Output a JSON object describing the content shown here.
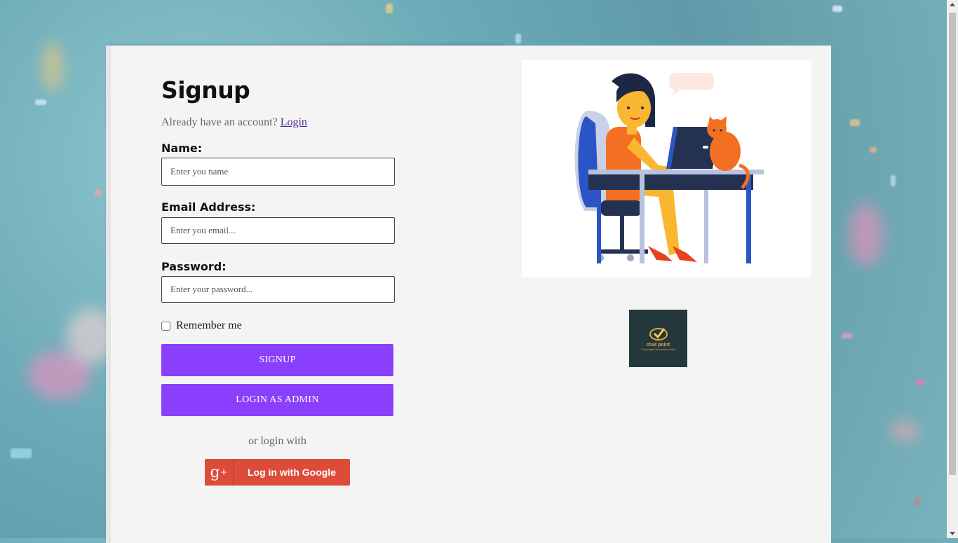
{
  "signup": {
    "title": "Signup",
    "have_account_text": "Already have an account?",
    "login_link": "Login",
    "name": {
      "label": "Name:",
      "placeholder": "Enter you name"
    },
    "email": {
      "label": "Email Address:",
      "placeholder": "Enter you email..."
    },
    "password": {
      "label": "Password:",
      "placeholder": "Enter your password..."
    },
    "remember_label": "Remember me",
    "signup_button": "SIGNUP",
    "admin_button": "LOGIN AS ADMIN",
    "or_login_with": "or login with",
    "google_button": "Log in with Google",
    "google_icon_text": "g"
  },
  "logo": {
    "brand": "chat point",
    "tagline": "Chat page Chat point online"
  },
  "colors": {
    "primary": "#8a3ffc",
    "google": "#dd4b39",
    "card": "#f4f4f4"
  },
  "icons": [
    "google-plus-icon",
    "checkmark-logo-icon"
  ]
}
